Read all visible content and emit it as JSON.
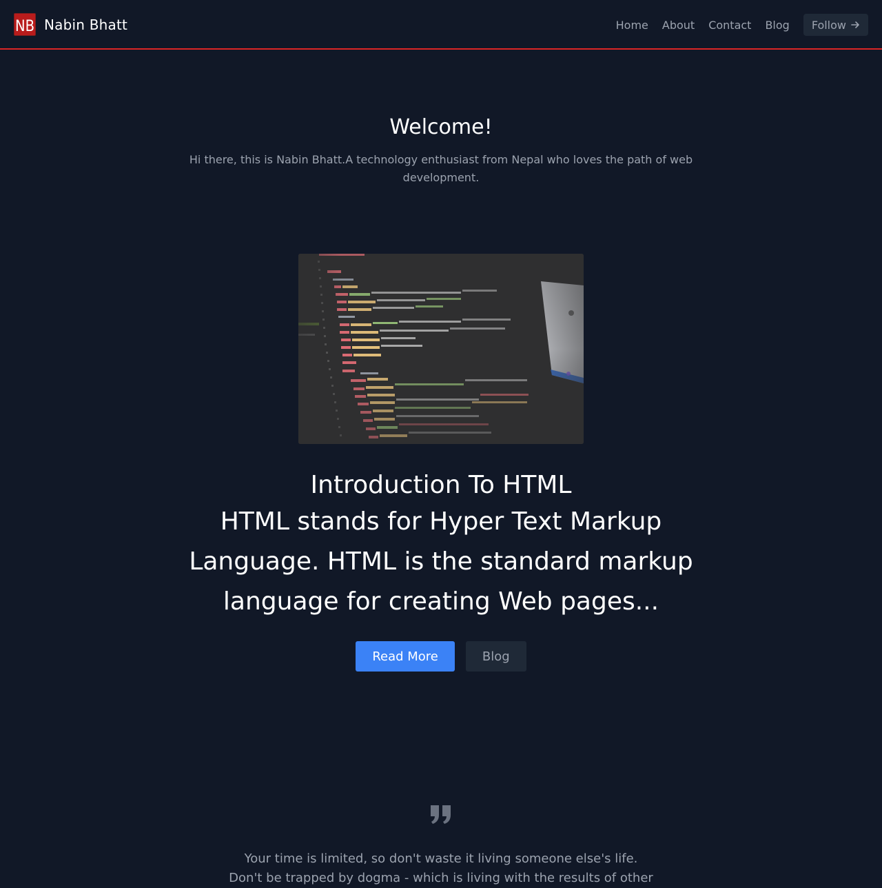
{
  "header": {
    "logo_text": "NB",
    "brand_name": "Nabin Bhatt",
    "nav": [
      "Home",
      "About",
      "Contact",
      "Blog"
    ],
    "follow_label": "Follow",
    "accent_color": "#dc2626"
  },
  "welcome": {
    "title": "Welcome!",
    "subtitle": "Hi there, this is Nabin Bhatt.A technology enthusiast from Nepal who loves the path of web development."
  },
  "hero_image": {
    "alt": "code editor screenshot"
  },
  "article": {
    "title": "Introduction To HTML",
    "summary": "HTML stands for Hyper Text Markup Language. HTML is the standard markup language for creating Web pages...",
    "read_more_label": "Read More",
    "blog_label": "Blog"
  },
  "quote": {
    "icon": "quote-icon",
    "line1": "Your time is limited, so don't waste it living someone else's life.",
    "line2": "Don't be trapped by dogma - which is living with the results of other"
  },
  "colors": {
    "background": "#111827",
    "primary_button": "#3b82f6",
    "secondary_button": "#1f2937"
  }
}
